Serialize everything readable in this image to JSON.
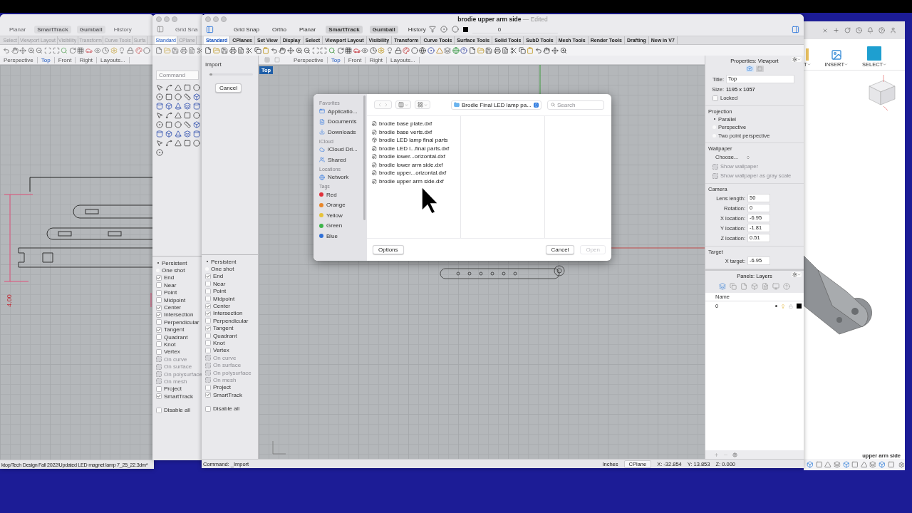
{
  "back_window": {
    "toggles": [
      {
        "label": "Planar",
        "on": false
      },
      {
        "label": "SmartTrack",
        "on": true
      },
      {
        "label": "Gumball",
        "on": true
      },
      {
        "label": "History",
        "on": false
      }
    ],
    "tabs": [
      {
        "label": "Select",
        "selected": false
      },
      {
        "label": "Viewport Layout",
        "selected": false
      },
      {
        "label": "Visibility",
        "selected": false
      },
      {
        "label": "Transform",
        "selected": false
      },
      {
        "label": "Curve Tools",
        "selected": false
      },
      {
        "label": "Surfa",
        "selected": false
      }
    ],
    "viewport_tabs": [
      {
        "label": "Perspective",
        "selected": false
      },
      {
        "label": "Top",
        "selected": true
      },
      {
        "label": "Front",
        "selected": false
      },
      {
        "label": "Right",
        "selected": false
      },
      {
        "label": "Layouts...",
        "selected": false
      }
    ],
    "dimension": "4.00",
    "status_path": "ktop/Tech Design Fall 2022/Updated LED magnet lamp 7_25_22.3dm*"
  },
  "middle_window": {
    "title": "Grid Sna",
    "tabs": [
      {
        "label": "Standard",
        "selected": true
      },
      {
        "label": "CPlane",
        "selected": false
      }
    ],
    "command_placeholder": "Command",
    "osnaps": [
      {
        "label": "Persistent",
        "kind": "radio",
        "selected": true
      },
      {
        "label": "One shot",
        "kind": "radio",
        "selected": false
      },
      {
        "label": "End",
        "kind": "check",
        "checked": true,
        "disabled": false
      },
      {
        "label": "Near",
        "kind": "check",
        "checked": false,
        "disabled": false
      },
      {
        "label": "Point",
        "kind": "check",
        "checked": false,
        "disabled": false
      },
      {
        "label": "Midpoint",
        "kind": "check",
        "checked": false,
        "disabled": false
      },
      {
        "label": "Center",
        "kind": "check",
        "checked": true,
        "disabled": false
      },
      {
        "label": "Intersection",
        "kind": "check",
        "checked": true,
        "disabled": false
      },
      {
        "label": "Perpendicular",
        "kind": "check",
        "checked": false,
        "disabled": false
      },
      {
        "label": "Tangent",
        "kind": "check",
        "checked": true,
        "disabled": false
      },
      {
        "label": "Quadrant",
        "kind": "check",
        "checked": false,
        "disabled": false
      },
      {
        "label": "Knot",
        "kind": "check",
        "checked": false,
        "disabled": false
      },
      {
        "label": "Vertex",
        "kind": "check",
        "checked": false,
        "disabled": false
      },
      {
        "label": "On curve",
        "kind": "check",
        "checked": false,
        "disabled": true
      },
      {
        "label": "On surface",
        "kind": "check",
        "checked": false,
        "disabled": true
      },
      {
        "label": "On polysurface",
        "kind": "check",
        "checked": false,
        "disabled": true
      },
      {
        "label": "On mesh",
        "kind": "check",
        "checked": false,
        "disabled": true
      },
      {
        "label": "Project",
        "kind": "check",
        "checked": false,
        "disabled": false
      },
      {
        "label": "SmartTrack",
        "kind": "check",
        "checked": true,
        "disabled": false
      }
    ],
    "disable_all": {
      "label": "Disable all",
      "checked": false
    }
  },
  "main_window": {
    "title": "brodie upper arm side",
    "title_status": "— Edited",
    "toggles": [
      {
        "label": "Grid Snap",
        "on": false
      },
      {
        "label": "Ortho",
        "on": false
      },
      {
        "label": "Planar",
        "on": false
      },
      {
        "label": "SmartTrack",
        "on": true
      },
      {
        "label": "Gumball",
        "on": true
      },
      {
        "label": "History",
        "on": false
      }
    ],
    "layer_field": "0",
    "tabs": [
      {
        "label": "Standard",
        "selected": true
      },
      {
        "label": "CPlanes",
        "selected": false
      },
      {
        "label": "Set View",
        "selected": false
      },
      {
        "label": "Display",
        "selected": false
      },
      {
        "label": "Select",
        "selected": false
      },
      {
        "label": "Viewport Layout",
        "selected": false
      },
      {
        "label": "Visibility",
        "selected": false
      },
      {
        "label": "Transform",
        "selected": false
      },
      {
        "label": "Curve Tools",
        "selected": false
      },
      {
        "label": "Surface Tools",
        "selected": false
      },
      {
        "label": "Solid Tools",
        "selected": false
      },
      {
        "label": "SubD Tools",
        "selected": false
      },
      {
        "label": "Mesh Tools",
        "selected": false
      },
      {
        "label": "Render Tools",
        "selected": false
      },
      {
        "label": "Drafting",
        "selected": false
      },
      {
        "label": "New in V7",
        "selected": false
      }
    ],
    "import_panel": {
      "title": "Import",
      "level": 0.06,
      "button": "Cancel"
    },
    "osnaps": [
      {
        "label": "Persistent",
        "kind": "radio",
        "selected": true
      },
      {
        "label": "One shot",
        "kind": "radio",
        "selected": false
      },
      {
        "label": "End",
        "kind": "check",
        "checked": true,
        "disabled": false
      },
      {
        "label": "Near",
        "kind": "check",
        "checked": false,
        "disabled": false
      },
      {
        "label": "Point",
        "kind": "check",
        "checked": false,
        "disabled": false
      },
      {
        "label": "Midpoint",
        "kind": "check",
        "checked": false,
        "disabled": false
      },
      {
        "label": "Center",
        "kind": "check",
        "checked": true,
        "disabled": false
      },
      {
        "label": "Intersection",
        "kind": "check",
        "checked": true,
        "disabled": false
      },
      {
        "label": "Perpendicular",
        "kind": "check",
        "checked": false,
        "disabled": false
      },
      {
        "label": "Tangent",
        "kind": "check",
        "checked": true,
        "disabled": false
      },
      {
        "label": "Quadrant",
        "kind": "check",
        "checked": false,
        "disabled": false
      },
      {
        "label": "Knot",
        "kind": "check",
        "checked": false,
        "disabled": false
      },
      {
        "label": "Vertex",
        "kind": "check",
        "checked": false,
        "disabled": false
      },
      {
        "label": "On curve",
        "kind": "check",
        "checked": false,
        "disabled": true
      },
      {
        "label": "On surface",
        "kind": "check",
        "checked": false,
        "disabled": true
      },
      {
        "label": "On polysurface",
        "kind": "check",
        "checked": false,
        "disabled": true
      },
      {
        "label": "On mesh",
        "kind": "check",
        "checked": false,
        "disabled": true
      },
      {
        "label": "Project",
        "kind": "check",
        "checked": false,
        "disabled": false
      },
      {
        "label": "SmartTrack",
        "kind": "check",
        "checked": true,
        "disabled": false
      }
    ],
    "disable_all": {
      "label": "Disable all",
      "checked": false
    },
    "viewport_tabs": [
      {
        "label": "Perspective",
        "selected": false
      },
      {
        "label": "Top",
        "selected": true
      },
      {
        "label": "Front",
        "selected": false
      },
      {
        "label": "Right",
        "selected": false
      },
      {
        "label": "Layouts...",
        "selected": false
      }
    ],
    "viewport_label": "Top",
    "properties": {
      "title": "Properties: Viewport",
      "view_tabs": [
        {
          "kind": "camera",
          "selected": true
        },
        {
          "kind": "page",
          "selected": false
        }
      ],
      "title_field": {
        "label": "Title:",
        "value": "Top"
      },
      "size": {
        "label": "Size:",
        "value": "1195 x 1057"
      },
      "locked": {
        "label": "Locked",
        "checked": false
      },
      "projection": {
        "heading": "Projection",
        "options": [
          {
            "label": "Parallel",
            "selected": true
          },
          {
            "label": "Perspective",
            "selected": false
          },
          {
            "label": "Two point perspective",
            "selected": false
          }
        ]
      },
      "wallpaper": {
        "heading": "Wallpaper",
        "choose": "Choose...",
        "options": [
          {
            "label": "Show wallpaper",
            "checked": false,
            "disabled": true
          },
          {
            "label": "Show wallpaper as gray scale",
            "checked": false,
            "disabled": true
          }
        ]
      },
      "camera": {
        "heading": "Camera",
        "fields": [
          {
            "label": "Lens length:",
            "value": "50"
          },
          {
            "label": "Rotation:",
            "value": "0"
          },
          {
            "label": "X location:",
            "value": "-6.95"
          },
          {
            "label": "Y location:",
            "value": "-1.81"
          },
          {
            "label": "Z location:",
            "value": "0.51"
          }
        ]
      },
      "target": {
        "heading": "Target",
        "fields": [
          {
            "label": "X target:",
            "value": "-6.95"
          }
        ]
      }
    },
    "layers": {
      "title": "Panels: Layers",
      "column": "Name",
      "rows": [
        {
          "name": "0",
          "current": true,
          "color": "#000000"
        }
      ]
    },
    "status": {
      "command": "Command: _Import",
      "units": "Inches",
      "cplane": "CPlane",
      "x": "X: -32.854",
      "y": "Y: 13.853",
      "z": "Z: 0.000"
    }
  },
  "dialog": {
    "sidebar": [
      {
        "heading": "Favorites",
        "items": [
          {
            "label": "Applicatio...",
            "kind": "apps"
          },
          {
            "label": "Documents",
            "kind": "doc"
          },
          {
            "label": "Downloads",
            "kind": "download"
          }
        ]
      },
      {
        "heading": "iCloud",
        "items": [
          {
            "label": "iCloud Dri...",
            "kind": "cloud"
          },
          {
            "label": "Shared",
            "kind": "shared"
          }
        ]
      },
      {
        "heading": "Locations",
        "items": [
          {
            "label": "Network",
            "kind": "network"
          }
        ]
      },
      {
        "heading": "Tags",
        "items": [
          {
            "label": "Red",
            "kind": "tag",
            "color": "#e0303a"
          },
          {
            "label": "Orange",
            "kind": "tag",
            "color": "#e8862a"
          },
          {
            "label": "Yellow",
            "kind": "tag",
            "color": "#e6c23a"
          },
          {
            "label": "Green",
            "kind": "tag",
            "color": "#3cb44a"
          },
          {
            "label": "Blue",
            "kind": "tag",
            "color": "#2f6fd6"
          }
        ]
      }
    ],
    "path": "Brodie Final LED lamp pa...",
    "search_placeholder": "Search",
    "files": [
      {
        "name": "brodie base plate.dxf",
        "kind": "dxf"
      },
      {
        "name": "brodie base verts.dxf",
        "kind": "dxf"
      },
      {
        "name": "brodie LED lamp final parts",
        "kind": "bundle"
      },
      {
        "name": "brodie LED l...final parts.dxf",
        "kind": "dxf"
      },
      {
        "name": "brodie lower...orizontal.dxf",
        "kind": "dxf"
      },
      {
        "name": "brodie lower arm side.dxf",
        "kind": "dxf"
      },
      {
        "name": "brodie upper...orizontal.dxf",
        "kind": "dxf"
      },
      {
        "name": "brodie upper arm side.dxf",
        "kind": "dxf"
      }
    ],
    "options_button": "Options",
    "buttons": [
      {
        "label": "Cancel",
        "disabled": false
      },
      {
        "label": "Open",
        "disabled": true
      }
    ]
  },
  "fusion": {
    "tools": [
      {
        "label": "T",
        "kind": "partial"
      },
      {
        "label": "INSERT",
        "kind": "insert"
      },
      {
        "label": "SELECT",
        "kind": "select"
      }
    ],
    "model_label": "upper arm side"
  }
}
